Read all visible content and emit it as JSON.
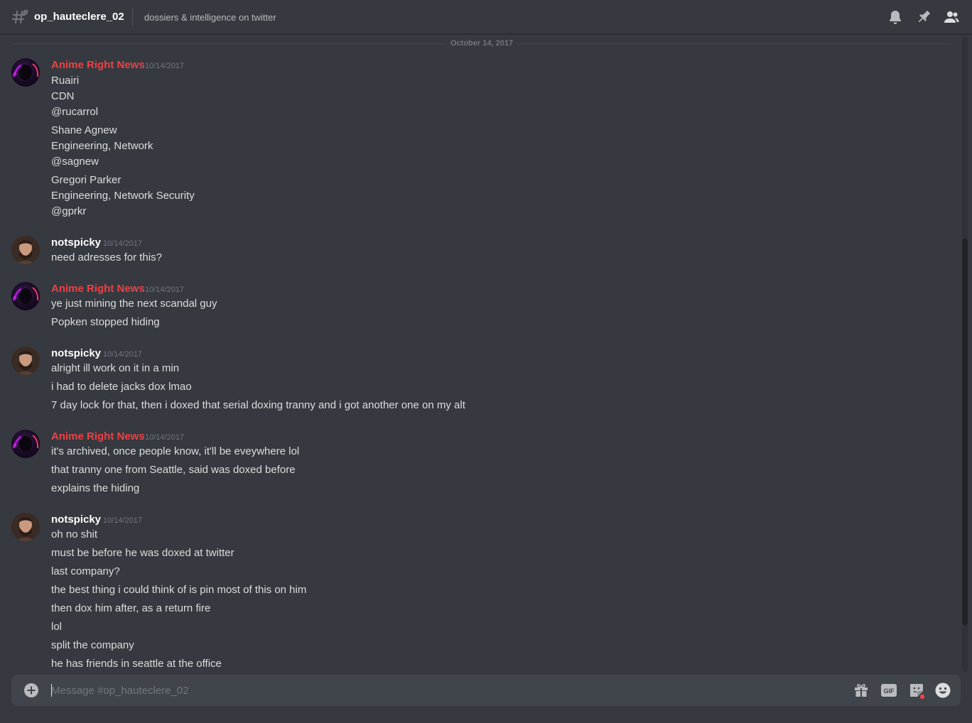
{
  "header": {
    "channel_name": "op_hauteclere_02",
    "topic": "dossiers & intelligence on twitter",
    "icons": [
      "hashtag-threads-icon",
      "bell-icon",
      "pin-icon",
      "members-icon"
    ]
  },
  "colors": {
    "background": "#36393f",
    "anime_username": "#ed4245",
    "default_username": "#ffffff",
    "composer": "#40444b"
  },
  "chat": {
    "date_divider": "October 14, 2017",
    "groups": [
      {
        "author": "Anime Right News",
        "timestamp": "10/14/2017",
        "lines": [
          "Ruairi",
          "CDN",
          "@rucarrol",
          "Shane Agnew",
          "Engineering, Network",
          "@sagnew",
          "Gregori Parker",
          "Engineering, Network Security",
          "@gprkr"
        ]
      },
      {
        "author": "notspicky",
        "timestamp": "10/14/2017",
        "lines": [
          "need adresses for this?"
        ]
      },
      {
        "author": "Anime Right News",
        "timestamp": "10/14/2017",
        "lines": [
          "ye just mining the next scandal guy",
          "Popken stopped hiding"
        ]
      },
      {
        "author": "notspicky",
        "timestamp": "10/14/2017",
        "lines": [
          "alright ill work on it in a min",
          "i had to delete jacks dox lmao",
          "7 day lock for that, then i doxed that serial doxing tranny and i got another one on my alt"
        ]
      },
      {
        "author": "Anime Right News",
        "timestamp": "10/14/2017",
        "lines": [
          "it's archived, once people know, it'll be eveywhere lol",
          "that tranny one from Seattle, said was doxed before",
          "explains the hiding"
        ]
      },
      {
        "author": "notspicky",
        "timestamp": "10/14/2017",
        "lines": [
          "oh no shit",
          "must be before he was doxed at twitter",
          "last company?",
          "the best thing i could think of is pin most of this on him",
          "then dox him after, as a return fire",
          "lol",
          "split the company",
          "he has friends in seattle at the office"
        ]
      }
    ]
  },
  "composer": {
    "placeholder": "Message #op_hauteclere_02",
    "gif_label": "GIF",
    "icons": [
      "add-circle-icon",
      "gift-icon",
      "gif-icon",
      "sticker-icon",
      "emoji-icon"
    ]
  }
}
